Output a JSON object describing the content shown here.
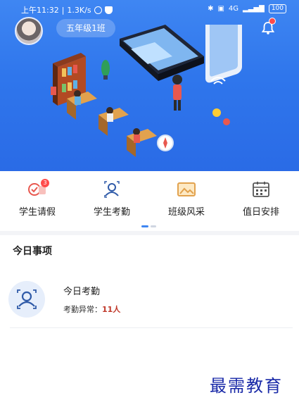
{
  "status_bar": {
    "time": "上午11:32",
    "speed": "1.3K/s",
    "network": "4G",
    "battery": "100"
  },
  "header": {
    "class_name": "五年级1班",
    "notification_count": ""
  },
  "menu": {
    "items": [
      {
        "label": "学生请假",
        "icon": "leave-request-icon",
        "badge": "3"
      },
      {
        "label": "学生考勤",
        "icon": "attendance-icon",
        "badge": ""
      },
      {
        "label": "班级风采",
        "icon": "class-gallery-icon",
        "badge": ""
      },
      {
        "label": "值日安排",
        "icon": "duty-calendar-icon",
        "badge": ""
      }
    ]
  },
  "today": {
    "title": "今日事项",
    "task": {
      "title": "今日考勤",
      "desc_label": "考勤异常：",
      "desc_value": "11人",
      "icon": "attendance-face-icon"
    }
  },
  "watermark": "最需教育",
  "colors": {
    "hero_blue": "#3f86f2",
    "accent_red": "#ff4b4b",
    "abnormal_red": "#c0392b",
    "watermark_blue": "#1a2aa8"
  }
}
